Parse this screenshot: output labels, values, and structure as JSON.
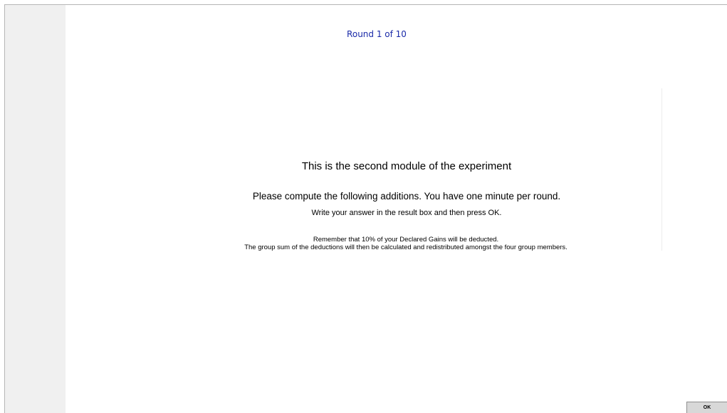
{
  "header": {
    "round_label": "Round 1 of 10"
  },
  "main": {
    "heading": "This is the second module of the experiment",
    "instruction_primary": "Please compute the following additions. You have one minute per round.",
    "instruction_secondary": "Write your answer in the result box and then press OK.",
    "note_line_1": "Remember that 10% of your Declared Gains will be deducted.",
    "note_line_2": "The group sum of the deductions will then be calculated and redistributed amongst the four group members."
  },
  "footer": {
    "ok_label": "OK"
  },
  "colors": {
    "round_label": "#1a2aa8",
    "left_panel": "#f0f0f0",
    "button_bg": "#d8d8d8"
  }
}
